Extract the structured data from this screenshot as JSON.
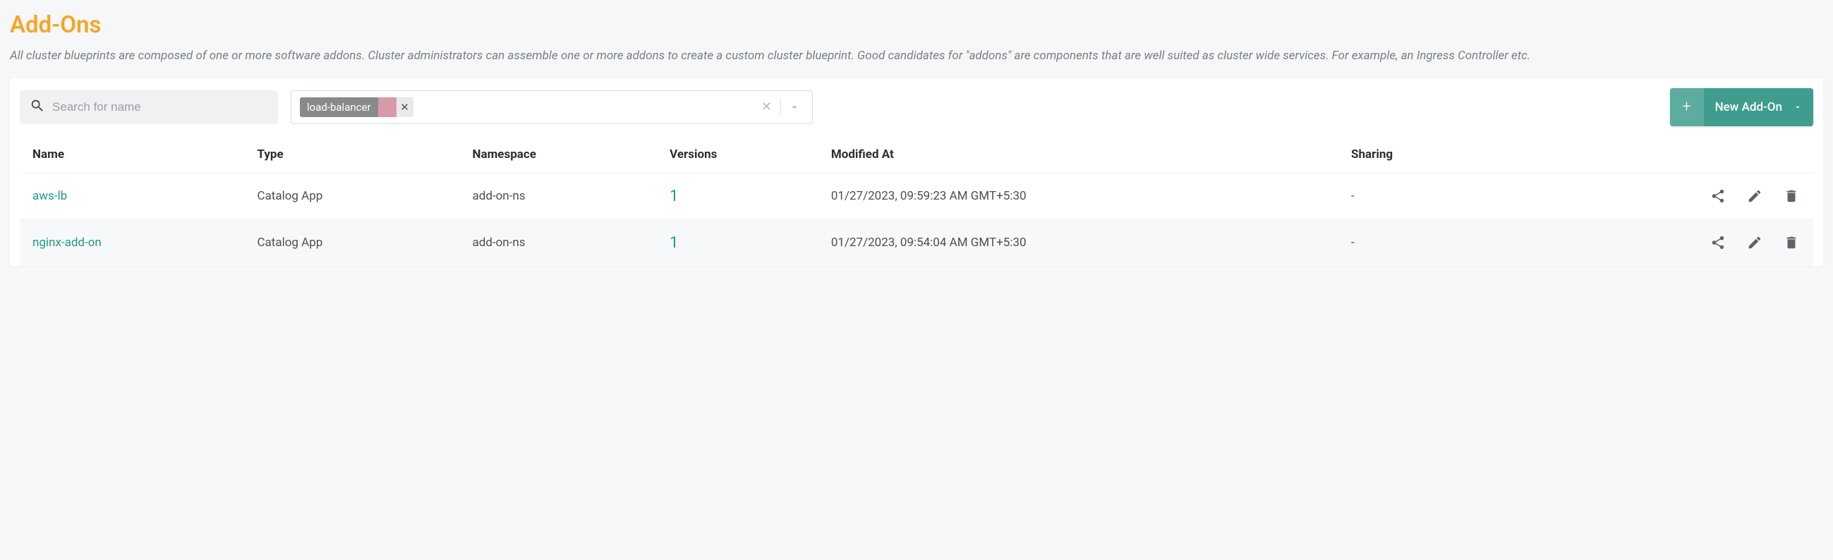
{
  "title": "Add-Ons",
  "description": "All cluster blueprints are composed of one or more software addons. Cluster administrators can assemble one or more addons to create a custom cluster blueprint. Good candidates for \"addons\" are components that are well suited as cluster wide services. For example, an Ingress Controller etc.",
  "search": {
    "placeholder": "Search for name",
    "value": ""
  },
  "filter": {
    "chip_label": "load-balancer"
  },
  "new_button_label": "New Add-On",
  "columns": {
    "name": "Name",
    "type": "Type",
    "namespace": "Namespace",
    "versions": "Versions",
    "modified": "Modified At",
    "sharing": "Sharing"
  },
  "rows": [
    {
      "name": "aws-lb",
      "type": "Catalog App",
      "namespace": "add-on-ns",
      "versions": "1",
      "modified": "01/27/2023, 09:59:23 AM GMT+5:30",
      "sharing": "-"
    },
    {
      "name": "nginx-add-on",
      "type": "Catalog App",
      "namespace": "add-on-ns",
      "versions": "1",
      "modified": "01/27/2023, 09:54:04 AM GMT+5:30",
      "sharing": "-"
    }
  ]
}
